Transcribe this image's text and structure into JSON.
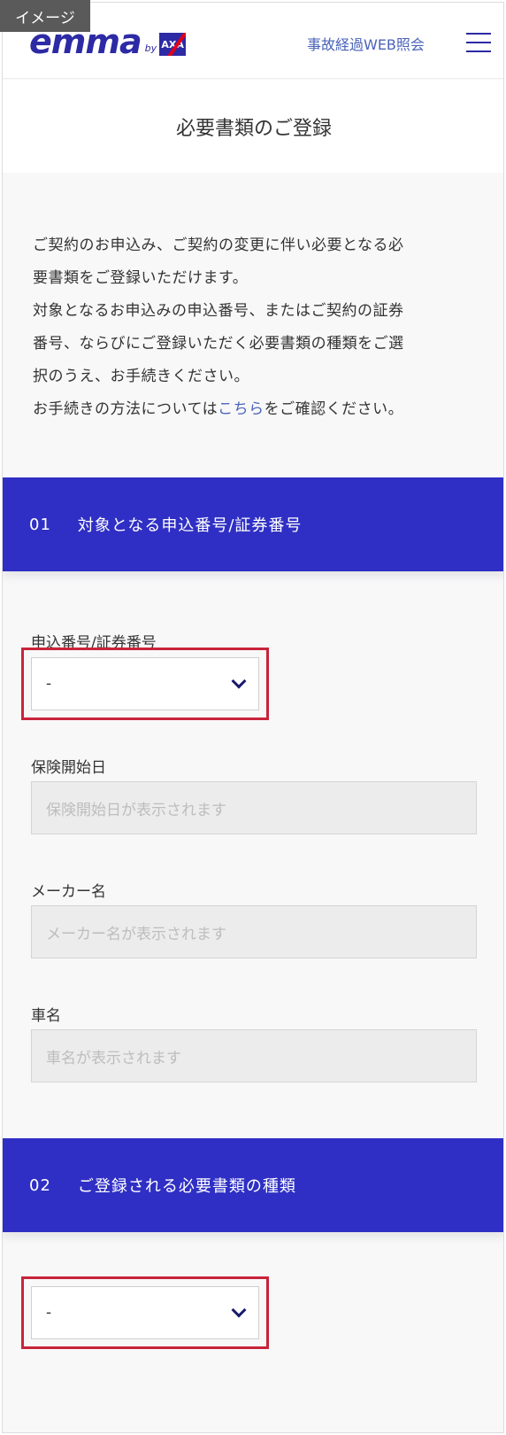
{
  "badge": "イメージ",
  "header": {
    "logo_text": "emma",
    "logo_by": "by",
    "logo_axa": "AXA",
    "link_label": "事故経過WEB照会",
    "menu_icon": "hamburger-menu-icon"
  },
  "page_title": "必要書類のご登録",
  "intro": {
    "line1": "ご契約のお申込み、ご契約の変更に伴い必要となる必",
    "line2": "要書類をご登録いただけます。",
    "line3": "対象となるお申込みの申込番号、またはご契約の証券",
    "line4": "番号、ならびにご登録いただく必要書類の種類をご選",
    "line5": "択のうえ、お手続きください。",
    "line6_pre": "お手続きの方法については",
    "line6_link": "こちら",
    "line6_post": "をご確認ください。"
  },
  "section1": {
    "number": "01",
    "title": "対象となる申込番号/証券番号",
    "fields": {
      "number_label": "申込番号/証券番号",
      "number_value": "-",
      "start_date_label": "保険開始日",
      "start_date_placeholder": "保険開始日が表示されます",
      "maker_label": "メーカー名",
      "maker_placeholder": "メーカー名が表示されます",
      "car_label": "車名",
      "car_placeholder": "車名が表示されます"
    }
  },
  "section2": {
    "number": "02",
    "title": "ご登録される必要書類の種類",
    "doc_type_value": "-"
  },
  "colors": {
    "brand": "#2d2aa5",
    "section_bar": "#2f2fc5",
    "link": "#4a63b8",
    "highlight": "#c8243a"
  }
}
